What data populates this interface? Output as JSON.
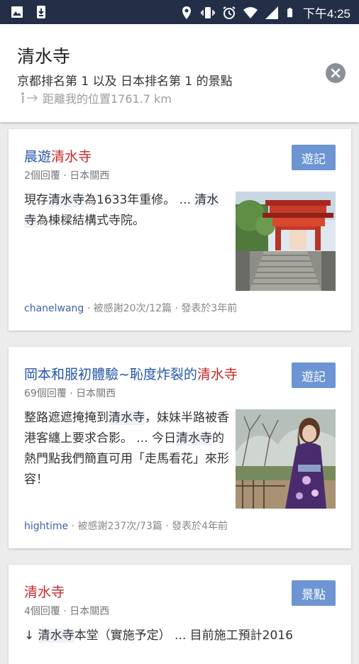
{
  "status_bar": {
    "time": "下午4:25",
    "icons": [
      "image-icon",
      "download-icon",
      "location-icon",
      "vibrate-icon",
      "alarm-icon",
      "wifi-icon",
      "signal-icon",
      "battery-icon"
    ]
  },
  "header": {
    "title": "清水寺",
    "subtitle": "京都排名第 1 以及 日本排名第 1 的景點",
    "distance": "距離我的位置1761.7 km"
  },
  "cards": [
    {
      "title_prefix": "晨遊",
      "title_highlight": "清水寺",
      "tag": "遊記",
      "meta": "2個回覆 · 日本關西",
      "excerpt_parts": [
        "現存",
        "清水寺",
        "為1633年重修。 ... ",
        "清水寺",
        "為棟樑結構式寺院。"
      ],
      "author": "chanelwang",
      "stats": " · 被感謝20次/12篇 · 發表於3年前"
    },
    {
      "title_prefix": "岡本和服初體驗~恥度炸裂的",
      "title_highlight": "清水寺",
      "tag": "遊記",
      "meta": "69個回覆 · 日本關西",
      "excerpt_parts": [
        "整路遮遮掩掩到",
        "清水寺",
        "，妹妹半路被香港客纏上要求合影。 ... 今日",
        "清水寺",
        "的熱門點我們簡直可用「走馬看花」來形容！"
      ],
      "author": "hightime",
      "stats": " · 被感謝237次/73篇 · 發表於4年前"
    },
    {
      "title_prefix": "",
      "title_highlight": "清水寺",
      "tag": "景點",
      "meta": "4個回覆 · 日本關西",
      "excerpt_parts": [
        "↓ ",
        "清水寺",
        "本堂（實施予定） ... 目前施工預計2016"
      ]
    }
  ],
  "colors": {
    "status_bar": "#232f47",
    "link_blue": "#2556a8",
    "highlight_red": "#c62828",
    "tag_blue": "#6d95d3"
  }
}
